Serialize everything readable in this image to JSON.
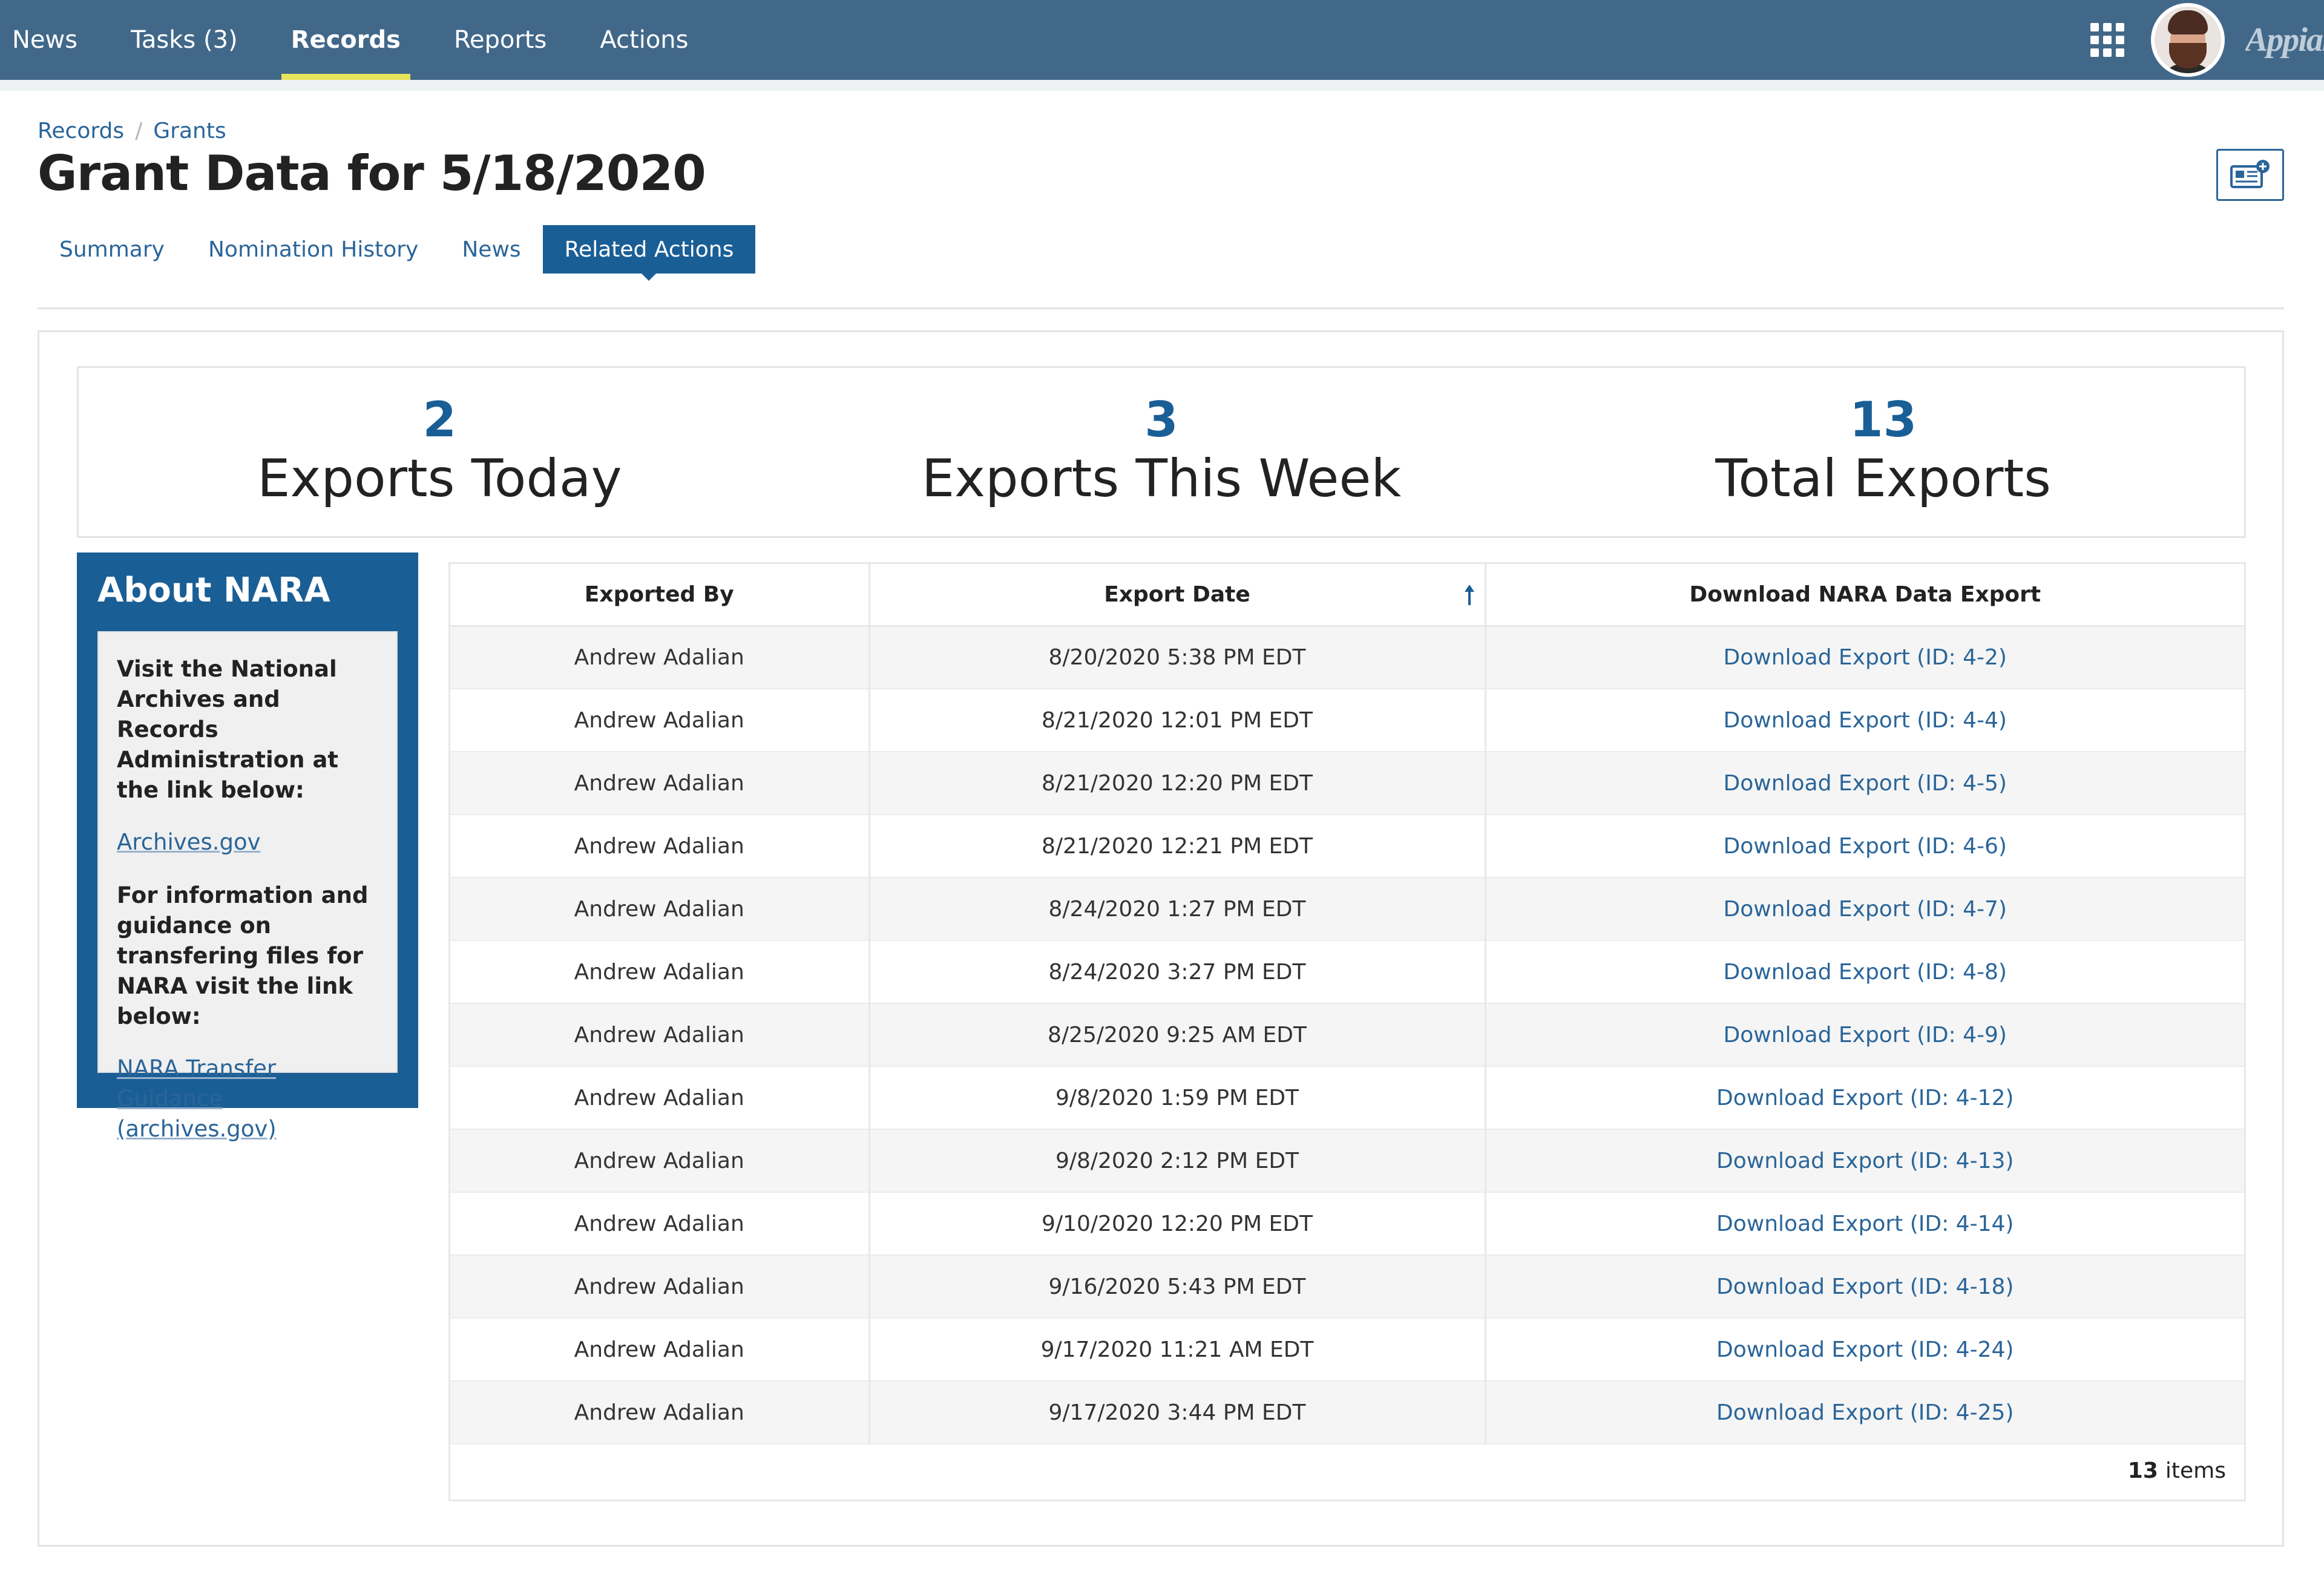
{
  "nav": {
    "items": [
      {
        "label": "News"
      },
      {
        "label": "Tasks (3)"
      },
      {
        "label": "Records"
      },
      {
        "label": "Reports"
      },
      {
        "label": "Actions"
      }
    ],
    "active": "Records",
    "brand": "Appian",
    "apps_icon": "grid-icon",
    "colors": {
      "bar": "#426889",
      "active_underline": "#e7e35a"
    }
  },
  "breadcrumb": {
    "items": [
      "Records",
      "Grants"
    ],
    "separator": "/"
  },
  "page": {
    "title": "Grant Data for 5/18/2020",
    "news_button_icon": "newspaper-plus-icon"
  },
  "tabs": {
    "items": [
      {
        "label": "Summary"
      },
      {
        "label": "Nomination History"
      },
      {
        "label": "News"
      },
      {
        "label": "Related Actions"
      }
    ],
    "active": "Related Actions",
    "colors": {
      "active_bg": "#1a5e96",
      "link": "#2a6599"
    }
  },
  "stats": [
    {
      "value": "2",
      "label": "Exports Today"
    },
    {
      "value": "3",
      "label": "Exports This Week"
    },
    {
      "value": "13",
      "label": "Total Exports"
    }
  ],
  "about": {
    "title": "About NARA",
    "text1": "Visit the National Archives and Records Administration at the link below:",
    "link1": "Archives.gov",
    "text2": "For information and guidance on transfering files for NARA visit the link below:",
    "link2": "NARA Transfer Guidance (archives.gov)"
  },
  "grid": {
    "columns": [
      "Exported By",
      "Export Date",
      "Download NARA Data Export"
    ],
    "sort": {
      "column": "Export Date",
      "direction": "ascending",
      "icon": "sort-up-arrow-icon"
    },
    "rows": [
      {
        "by": "Andrew Adalian",
        "date": "8/20/2020 5:38 PM EDT",
        "link": "Download Export (ID: 4-2)"
      },
      {
        "by": "Andrew Adalian",
        "date": "8/21/2020 12:01 PM EDT",
        "link": "Download Export (ID: 4-4)"
      },
      {
        "by": "Andrew Adalian",
        "date": "8/21/2020 12:20 PM EDT",
        "link": "Download Export (ID: 4-5)"
      },
      {
        "by": "Andrew Adalian",
        "date": "8/21/2020 12:21 PM EDT",
        "link": "Download Export (ID: 4-6)"
      },
      {
        "by": "Andrew Adalian",
        "date": "8/24/2020 1:27 PM EDT",
        "link": "Download Export (ID: 4-7)"
      },
      {
        "by": "Andrew Adalian",
        "date": "8/24/2020 3:27 PM EDT",
        "link": "Download Export (ID: 4-8)"
      },
      {
        "by": "Andrew Adalian",
        "date": "8/25/2020 9:25 AM EDT",
        "link": "Download Export (ID: 4-9)"
      },
      {
        "by": "Andrew Adalian",
        "date": "9/8/2020 1:59 PM EDT",
        "link": "Download Export (ID: 4-12)"
      },
      {
        "by": "Andrew Adalian",
        "date": "9/8/2020 2:12 PM EDT",
        "link": "Download Export (ID: 4-13)"
      },
      {
        "by": "Andrew Adalian",
        "date": "9/10/2020 12:20 PM EDT",
        "link": "Download Export (ID: 4-14)"
      },
      {
        "by": "Andrew Adalian",
        "date": "9/16/2020 5:43 PM EDT",
        "link": "Download Export (ID: 4-18)"
      },
      {
        "by": "Andrew Adalian",
        "date": "9/17/2020 11:21 AM EDT",
        "link": "Download Export (ID: 4-24)"
      },
      {
        "by": "Andrew Adalian",
        "date": "9/17/2020 3:44 PM EDT",
        "link": "Download Export (ID: 4-25)"
      }
    ],
    "footer": {
      "count": "13",
      "suffix": "items"
    }
  }
}
